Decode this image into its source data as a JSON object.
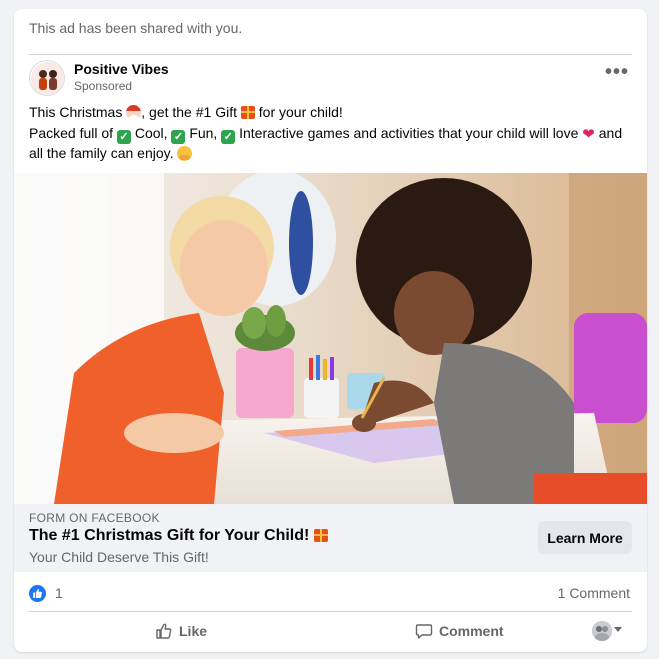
{
  "banner": {
    "text": "This ad has been shared with you."
  },
  "post": {
    "page_name": "Positive Vibes",
    "sponsored_label": "Sponsored",
    "text": {
      "line1_part1": "This Christmas",
      "line1_part2": ", get the #1 Gift",
      "line1_part3": "for your child!",
      "line2_part1": "Packed full of",
      "line2_part2": "Cool,",
      "line2_part3": "Fun,",
      "line2_part4": "Interactive games and activities that your child will love",
      "line2_part5": "and all the family can enjoy.",
      "check_mark": "✓",
      "heart": "❤"
    },
    "emojis": [
      "santa-emoji",
      "gift-emoji",
      "check-emoji",
      "heart-emoji",
      "hug-emoji"
    ]
  },
  "cta": {
    "form_label": "FORM ON FACEBOOK",
    "title": "The #1 Christmas Gift for Your Child!",
    "subtitle": "Your Child Deserve This Gift!",
    "button_label": "Learn More"
  },
  "reactions": {
    "count": "1",
    "comments": "1 Comment"
  },
  "actions": {
    "like_label": "Like",
    "comment_label": "Comment"
  },
  "more_label": "•••",
  "colors": {
    "accent": "#1877f2",
    "background": "#f0f2f5",
    "secondary_text": "#65676b"
  }
}
